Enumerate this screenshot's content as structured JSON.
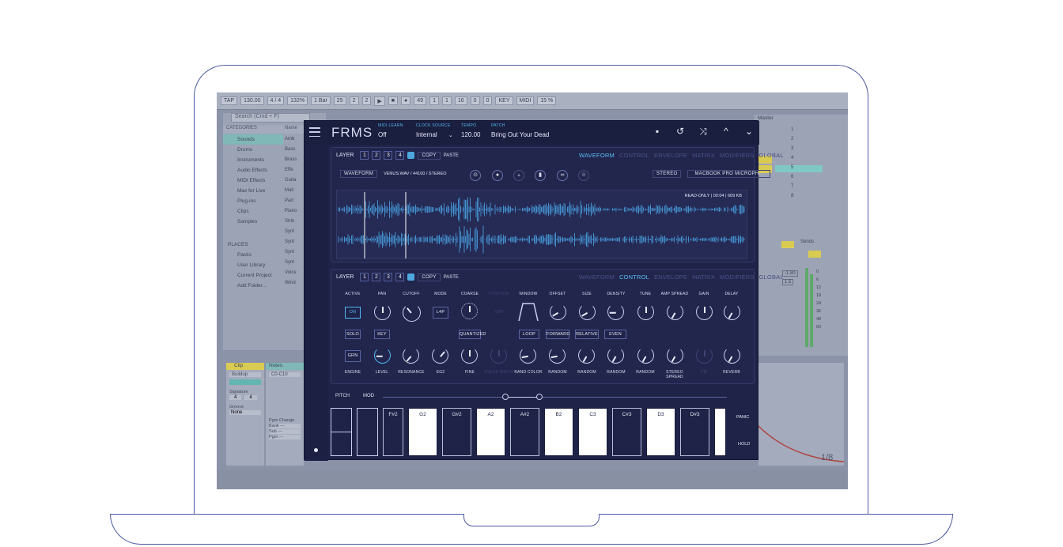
{
  "daw": {
    "tempo": "130.00",
    "time_sig": "4 / 4",
    "zoom": "132%",
    "bars": "1 Bar",
    "pos1": "25",
    "pos2": "2",
    "pos3": "2",
    "pos4": "49",
    "pos5": "1",
    "pos6": "1",
    "pos7": "16",
    "pos8": "0",
    "pos9": "0",
    "key": "KEY",
    "midi": "MIDI",
    "cpu": "15 %",
    "search_placeholder": "Search (Cmd + F)",
    "categories_header": "CATEGORIES",
    "name_header": "Name",
    "categories": [
      "Sounds",
      "Drums",
      "Instruments",
      "Audio Effects",
      "MIDI Effects",
      "Max for Live",
      "Plug-ins",
      "Clips",
      "Samples"
    ],
    "names": [
      "Amb",
      "Bass",
      "Brass",
      "Effe",
      "Guita",
      "Mall",
      "Pad",
      "Piano",
      "Strin",
      "Synt",
      "Synt",
      "Synt",
      "Synt",
      "Voice",
      "Wind"
    ],
    "places_header": "PLACES",
    "places": [
      "Packs",
      "User Library",
      "Current Project",
      "Add Folder..."
    ],
    "master_label": "Master",
    "master_rows": [
      "1",
      "2",
      "3",
      "4",
      "5",
      "6",
      "7",
      "8"
    ],
    "clip_label": "Clip",
    "notes_label": "Notes",
    "clip_name": "Buildup",
    "clip_range": "C0-C10",
    "signature": "Signature",
    "sig1": "4",
    "sig2": "4",
    "groove": "Groove",
    "groove_val": "None",
    "pgm_change": "Pgm Change",
    "bank": "Bank ---",
    "sub": "Sub ---",
    "pgm": "Pgm ---",
    "page_counter": "1/8",
    "send_labels": [
      "Sends",
      "Post"
    ],
    "meter_vals": [
      "-1.80",
      "1.5"
    ],
    "scale_vals": [
      "0",
      "6",
      "12",
      "18",
      "24",
      "36",
      "48",
      "60"
    ]
  },
  "plugin": {
    "logo": "FRMS",
    "midi_learn_label": "MIDI LEARN",
    "midi_learn_val": "Off",
    "clock_label": "CLOCK SOURCE",
    "clock_val": "Internal",
    "tempo_label": "TEMPO",
    "tempo_val": "120.00",
    "patch_label": "PATCH",
    "patch_val": "Bring Out Your Dead",
    "layer_label": "LAYER",
    "layer_nums": [
      "1",
      "2",
      "3",
      "4"
    ],
    "copy": "COPY",
    "paste": "PASTE",
    "tabs": [
      "WAVEFORM",
      "CONTROL",
      "ENVELOPE",
      "MATRIX",
      "MODIFIERS",
      "GLOBAL"
    ],
    "waveform_btn": "WAVEFORM",
    "file_info": "VENUS.WAV / 44100 / STEREO",
    "stereo": "STEREO",
    "device": "MACBOOK PRO MICROPH...",
    "readonly": "READ-ONLY | 00:04 | 609 KB",
    "controls_top": [
      "ACTIVE",
      "PAN",
      "CUTOFF",
      "MODE",
      "COARSE",
      "POSITION",
      "WINDOW",
      "OFFSET",
      "SIZE",
      "DENSITY",
      "TUNE",
      "AMP SPREAD",
      "GAIN",
      "DELAY"
    ],
    "controls_bottom": [
      "ENGINE",
      "LEVEL",
      "RESONANCE",
      "EG2",
      "FINE",
      "PULSE WIDTH",
      "RAND COLOR",
      "RANDOM",
      "RANDOM",
      "RANDOM",
      "RANDOM",
      "STEREO SPREAD",
      "FM",
      "REVERB"
    ],
    "on": "ON",
    "l4p": "L4P",
    "off": "OFF",
    "solo": "SOLO",
    "key": "KEY",
    "quantized": "QUANTIZED",
    "loop": "LOOP",
    "forward": "FORWARD",
    "relative": "RELATIVE",
    "even": "EVEN",
    "grn": "GRN",
    "pitch": "PITCH",
    "mod": "MOD",
    "keys": [
      "F#2",
      "G2",
      "G#2",
      "A2",
      "A#2",
      "B2",
      "C3",
      "C#3",
      "D3",
      "D#3"
    ],
    "panic": "PANIC",
    "hold": "HOLD"
  },
  "colors": {
    "accent": "#5bbdf0",
    "plugin_bg": "#1f2347",
    "laptop_outline": "#4a5a9e",
    "daw_bg": "#8a93a8"
  }
}
